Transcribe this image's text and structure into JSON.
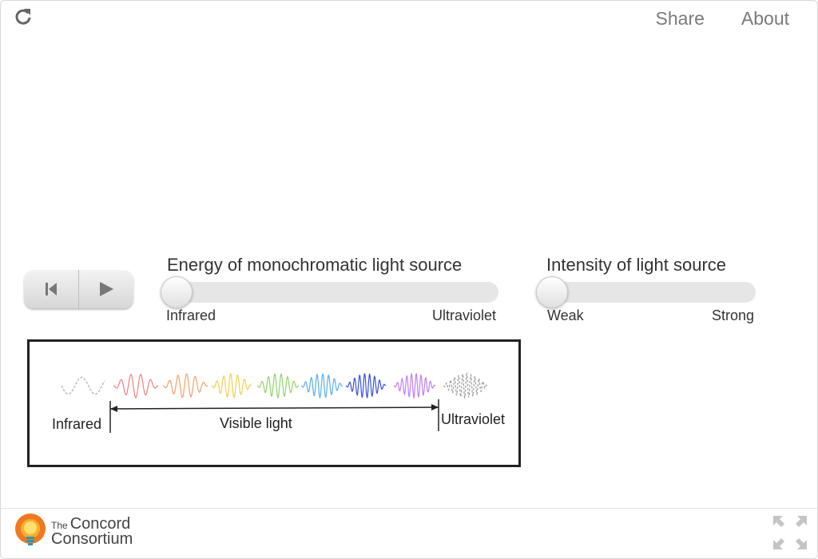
{
  "nav": {
    "share_label": "Share",
    "about_label": "About"
  },
  "controls": {
    "energy": {
      "title": "Energy of monochromatic light source",
      "min_label": "Infrared",
      "max_label": "Ultraviolet",
      "value_fraction": 0
    },
    "intensity": {
      "title": "Intensity of light source",
      "min_label": "Weak",
      "max_label": "Strong",
      "value_fraction": 0
    }
  },
  "spectrum_image": {
    "infrared_label": "Infrared",
    "visible_label": "Visible light",
    "ultraviolet_label": "Ultraviolet",
    "wave_colors": [
      "#aaaaaa",
      "#f08080",
      "#f4a06a",
      "#f2d050",
      "#8fd46a",
      "#5aaef0",
      "#3a50e0",
      "#c080f0",
      "#999999"
    ]
  },
  "footer": {
    "logo_the": "The",
    "logo_line1": "Concord",
    "logo_line2": "Consortium"
  },
  "icons": {
    "reload": "reload-icon",
    "rewind": "skip-back-icon",
    "play": "play-icon",
    "fullscreen": "fullscreen-icon"
  }
}
